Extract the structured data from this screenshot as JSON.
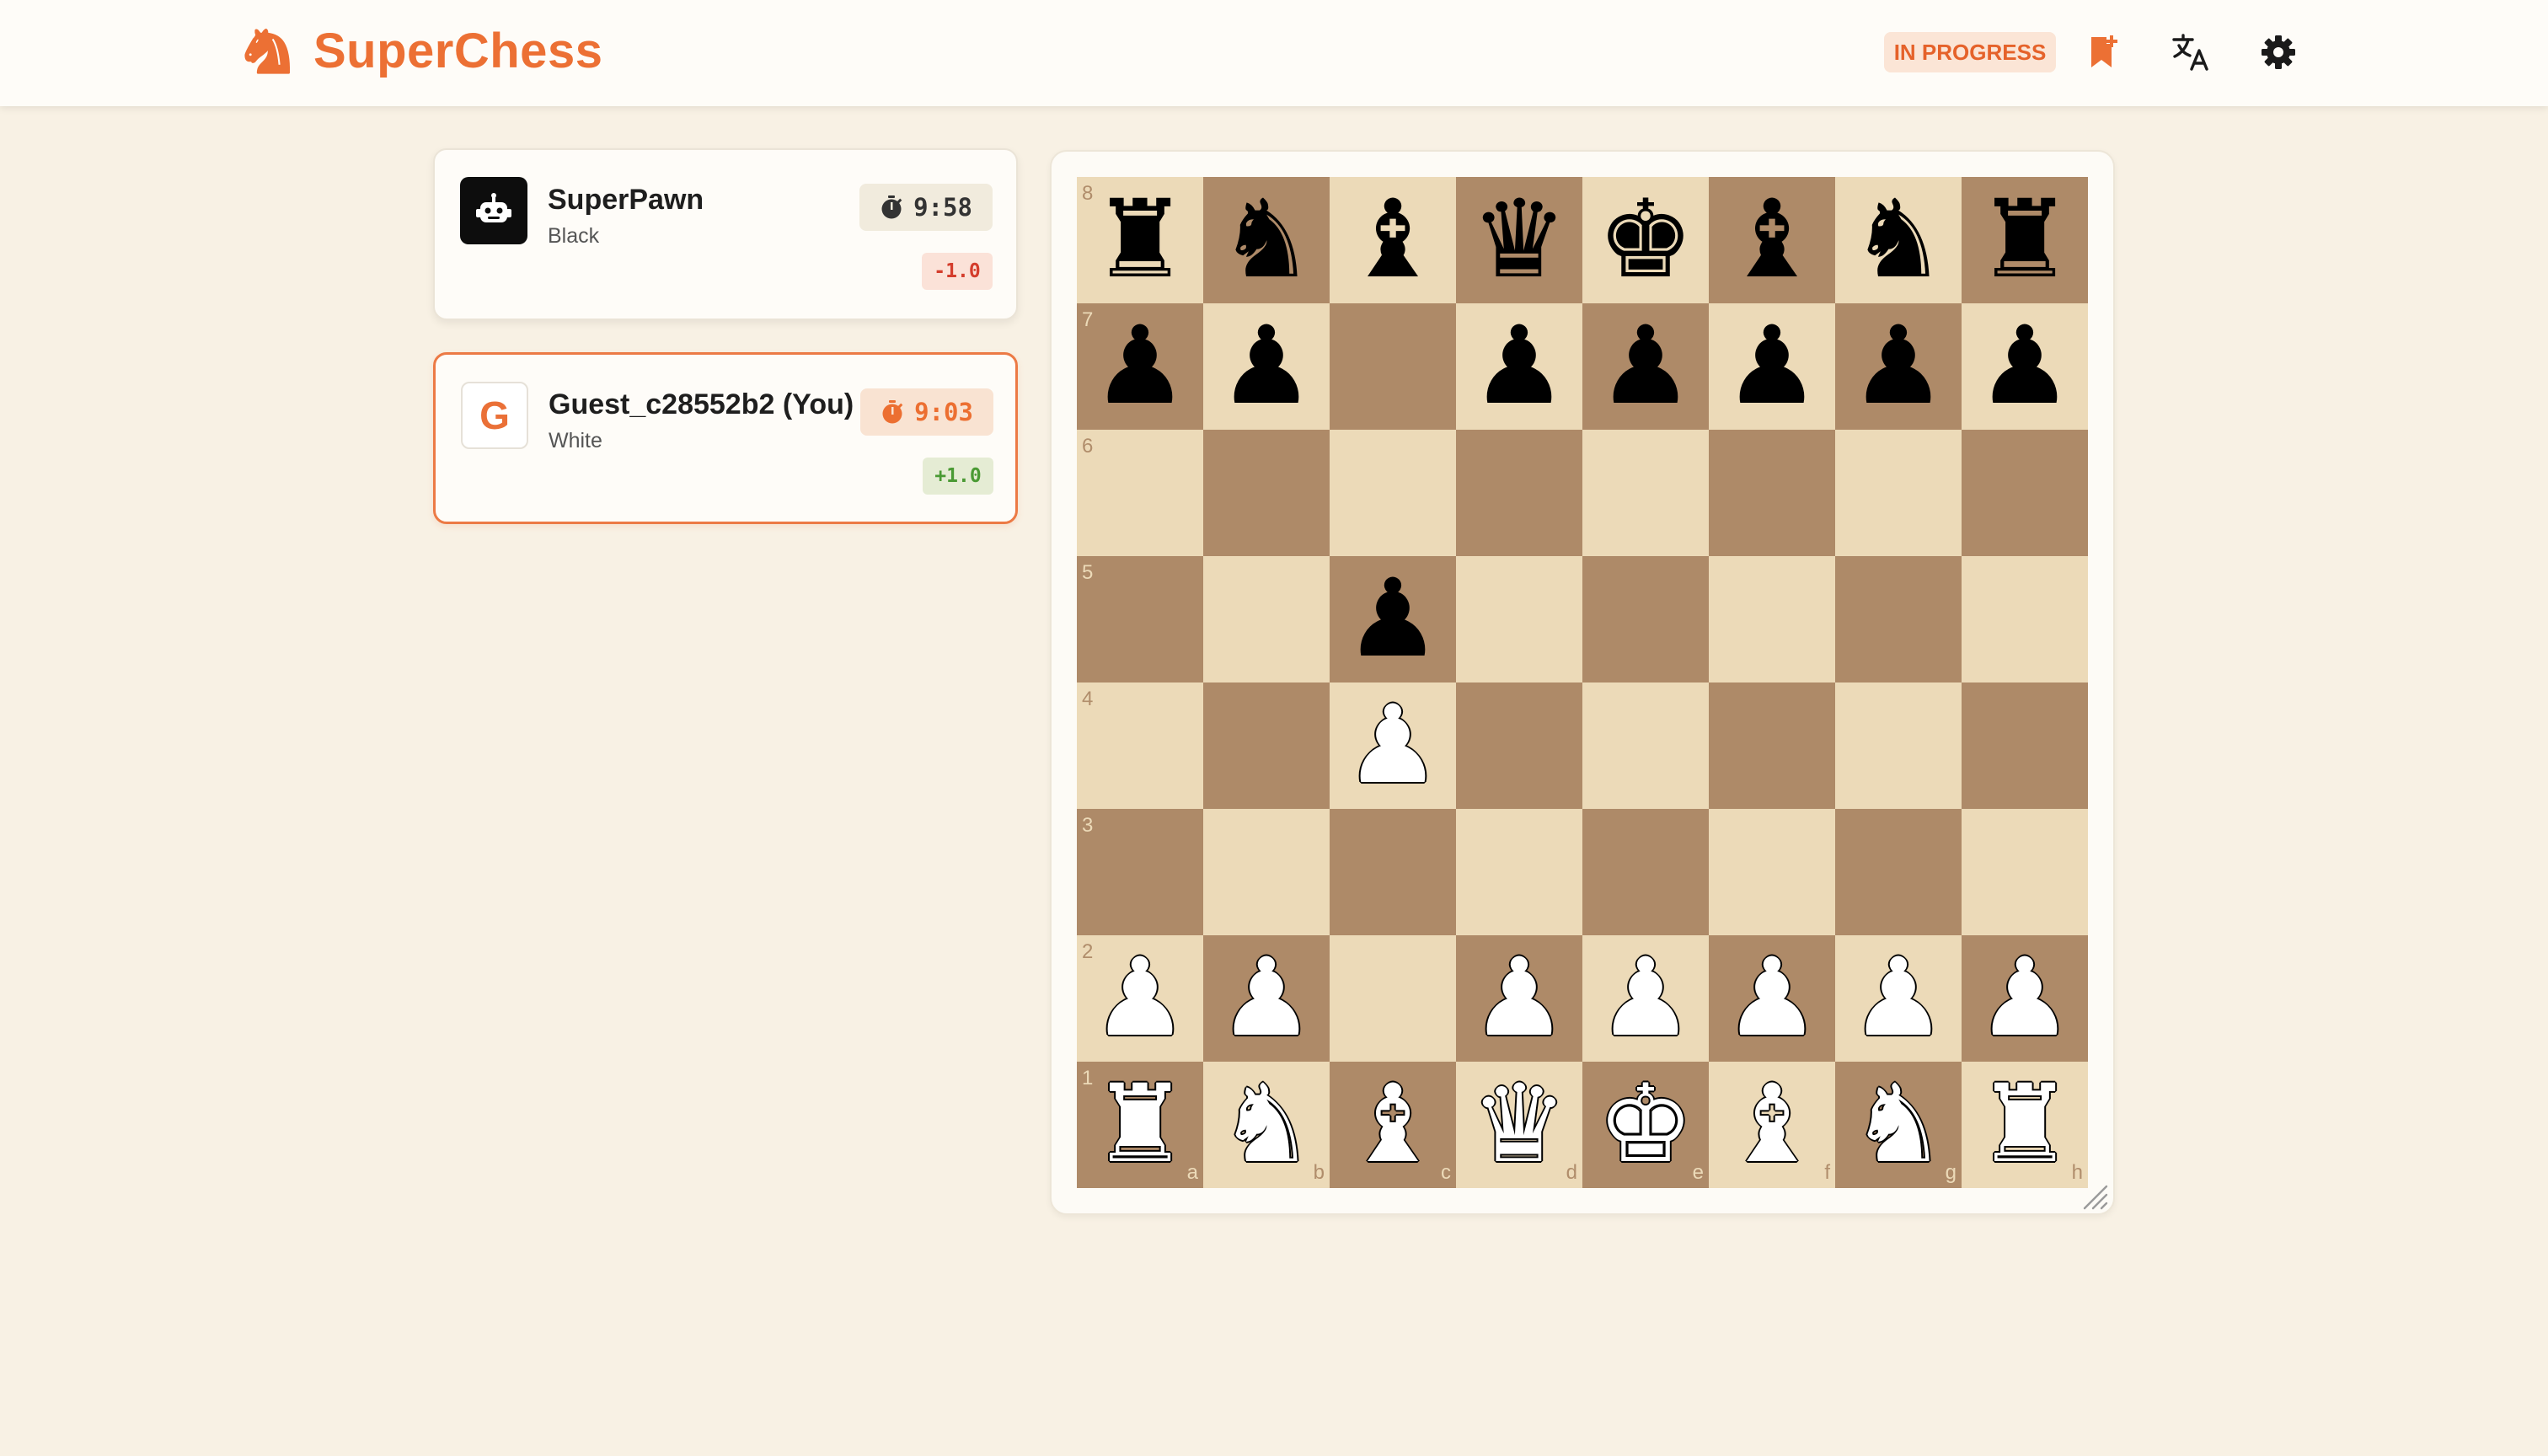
{
  "app": {
    "name": "SuperChess",
    "brand_color": "#ec7034"
  },
  "header": {
    "status": "IN PROGRESS",
    "icons": [
      "bookmark-add-icon",
      "translate-icon",
      "gear-icon"
    ]
  },
  "players": [
    {
      "name": "SuperPawn",
      "color": "Black",
      "time": "9:58",
      "score": "-1.0",
      "avatar": "robot-icon",
      "active": false
    },
    {
      "name": "Guest_c28552b2 (You)",
      "color": "White",
      "time": "9:03",
      "score": "+1.0",
      "avatar_letter": "G",
      "active": true
    }
  ],
  "board": {
    "light_square": "#ecdab8",
    "dark_square": "#ae8a68",
    "files": [
      "a",
      "b",
      "c",
      "d",
      "e",
      "f",
      "g",
      "h"
    ],
    "ranks": [
      "8",
      "7",
      "6",
      "5",
      "4",
      "3",
      "2",
      "1"
    ],
    "position": [
      [
        "bR",
        "bN",
        "bB",
        "bQ",
        "bK",
        "bB",
        "bN",
        "bR"
      ],
      [
        "bP",
        "bP",
        "",
        "bP",
        "bP",
        "bP",
        "bP",
        "bP"
      ],
      [
        "",
        "",
        "",
        "",
        "",
        "",
        "",
        ""
      ],
      [
        "",
        "",
        "bP",
        "",
        "",
        "",
        "",
        ""
      ],
      [
        "",
        "",
        "wP",
        "",
        "",
        "",
        "",
        ""
      ],
      [
        "",
        "",
        "",
        "",
        "",
        "",
        "",
        ""
      ],
      [
        "wP",
        "wP",
        "",
        "wP",
        "wP",
        "wP",
        "wP",
        "wP"
      ],
      [
        "wR",
        "wN",
        "wB",
        "wQ",
        "wK",
        "wB",
        "wN",
        "wR"
      ]
    ]
  }
}
